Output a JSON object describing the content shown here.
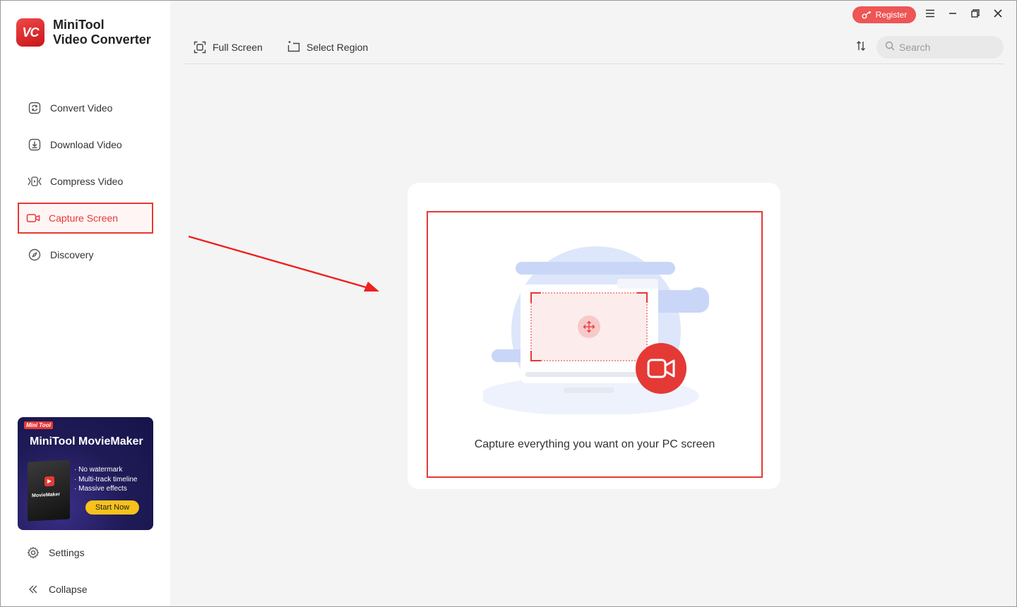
{
  "app": {
    "name_line1": "MiniTool",
    "name_line2": "Video Converter",
    "logo_text": "VC"
  },
  "sidebar": {
    "items": [
      {
        "label": "Convert Video",
        "icon": "convert-icon"
      },
      {
        "label": "Download Video",
        "icon": "download-icon"
      },
      {
        "label": "Compress Video",
        "icon": "compress-icon"
      },
      {
        "label": "Capture Screen",
        "icon": "camera-icon",
        "active": true
      },
      {
        "label": "Discovery",
        "icon": "compass-icon"
      }
    ],
    "settings_label": "Settings",
    "collapse_label": "Collapse"
  },
  "promo": {
    "badge": "Mini Tool",
    "title": "MiniTool MovieMaker",
    "box_label": "MovieMaker",
    "features": [
      "· No watermark",
      "· Multi-track timeline",
      "· Massive effects"
    ],
    "cta": "Start Now"
  },
  "toolbar": {
    "full_screen_label": "Full Screen",
    "select_region_label": "Select Region",
    "search_placeholder": "Search"
  },
  "titlebar": {
    "register_label": "Register"
  },
  "main": {
    "caption": "Capture everything you want on your PC screen"
  },
  "colors": {
    "accent": "#e53935",
    "register": "#ee5555",
    "promo_bg": "#1f1b57",
    "promo_cta": "#f6c21b"
  }
}
